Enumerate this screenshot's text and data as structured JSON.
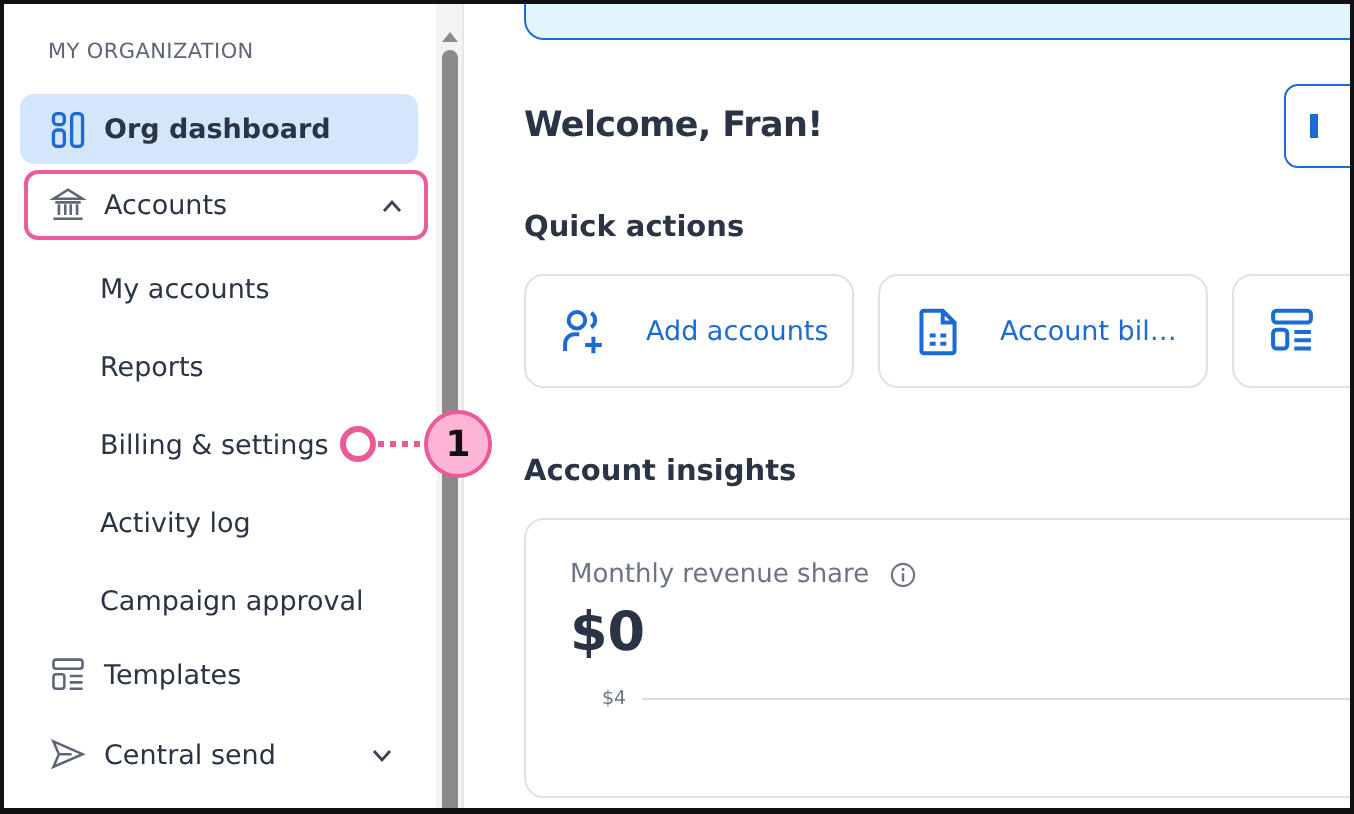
{
  "sidebar": {
    "heading": "MY ORGANIZATION",
    "items": [
      {
        "label": "Org dashboard",
        "kind": "dashboard",
        "selected": true
      },
      {
        "label": "Accounts",
        "kind": "bank",
        "selected": false,
        "highlighted": true,
        "expanded": true,
        "children": [
          {
            "label": "My accounts",
            "selected": false
          },
          {
            "label": "Reports",
            "selected": false
          },
          {
            "label": "Billing & settings",
            "selected": false,
            "callout": "1"
          },
          {
            "label": "Activity log",
            "selected": false
          },
          {
            "label": "Campaign approval",
            "selected": false
          }
        ]
      },
      {
        "label": "Templates",
        "kind": "layout",
        "selected": false
      },
      {
        "label": "Central send",
        "kind": "send",
        "selected": false,
        "expanded": false
      }
    ]
  },
  "main": {
    "greeting": "Welcome, Fran!",
    "quick_actions": {
      "title": "Quick actions",
      "items": [
        {
          "kind": "person-plus",
          "label": "Add accounts"
        },
        {
          "kind": "document",
          "label": "Account bil…"
        },
        {
          "kind": "layout"
        }
      ]
    },
    "insights": {
      "title": "Account insights",
      "card": {
        "title": "Monthly revenue share",
        "value": "$0",
        "axis_tick": "$4"
      }
    }
  }
}
